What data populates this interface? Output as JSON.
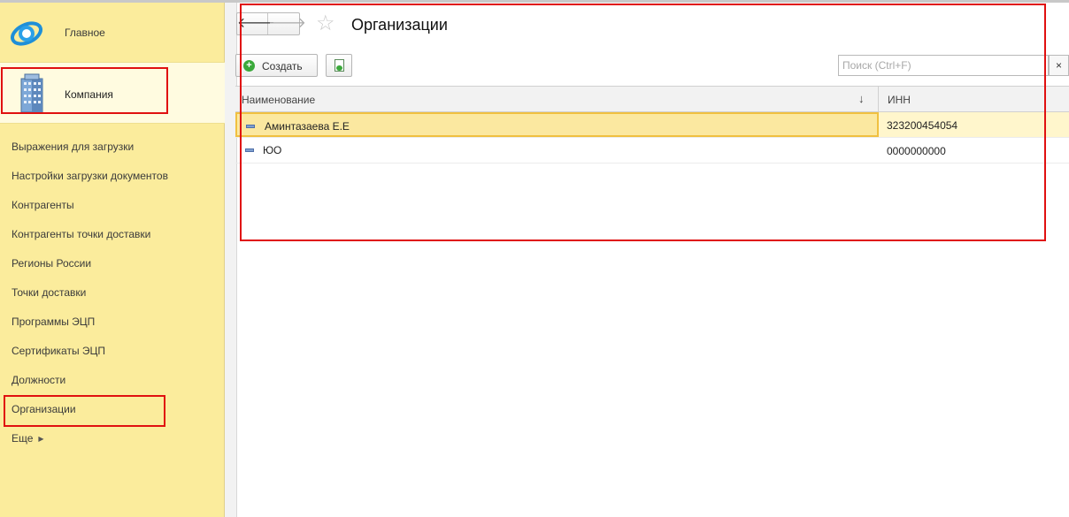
{
  "sidebar": {
    "main_label": "Главное",
    "section_label": "Компания",
    "items": [
      {
        "label": "Выражения для загрузки"
      },
      {
        "label": "Настройки загрузки документов"
      },
      {
        "label": "Контрагенты"
      },
      {
        "label": "Контрагенты точки доставки"
      },
      {
        "label": "Регионы России"
      },
      {
        "label": "Точки доставки"
      },
      {
        "label": "Программы ЭЦП"
      },
      {
        "label": "Сертификаты ЭЦП"
      },
      {
        "label": "Должности"
      },
      {
        "label": "Организации"
      }
    ],
    "more_label": "Еще"
  },
  "header": {
    "title": "Организации"
  },
  "toolbar": {
    "create_label": "Создать",
    "search_placeholder": "Поиск (Ctrl+F)",
    "clear_label": "×"
  },
  "table": {
    "columns": {
      "name": "Наименование",
      "inn": "ИНН"
    },
    "rows": [
      {
        "name": "Аминтазаева Е.Е",
        "inn": "323200454054"
      },
      {
        "name": "ЮО",
        "inn": "0000000000"
      }
    ]
  },
  "colors": {
    "sidebar_bg": "#fbec9c",
    "selected_row": "#fbe8a0",
    "highlight_box": "#e01010"
  }
}
